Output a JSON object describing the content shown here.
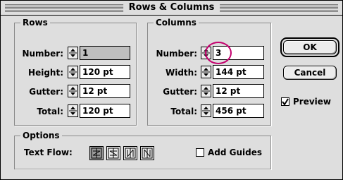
{
  "dialog": {
    "title": "Rows & Columns",
    "rows": {
      "legend": "Rows",
      "number_label": "Number:",
      "number_value": "1",
      "height_label": "Height:",
      "height_value": "120 pt",
      "gutter_label": "Gutter:",
      "gutter_value": "12 pt",
      "total_label": "Total:",
      "total_value": "120 pt"
    },
    "columns": {
      "legend": "Columns",
      "number_label": "Number:",
      "number_value": "3",
      "width_label": "Width:",
      "width_value": "144 pt",
      "gutter_label": "Gutter:",
      "gutter_value": "12 pt",
      "total_label": "Total:",
      "total_value": "456 pt"
    },
    "options": {
      "legend": "Options",
      "text_flow_label": "Text Flow:",
      "text_flow_icons": [
        "flow-left-right-top-down-icon",
        "flow-right-left-top-down-icon",
        "flow-top-down-left-right-icon",
        "flow-top-down-right-left-icon"
      ],
      "add_guides_label": "Add Guides",
      "add_guides_checked": false
    },
    "buttons": {
      "ok": "OK",
      "cancel": "Cancel"
    },
    "preview": {
      "label": "Preview",
      "checked": true
    },
    "highlight_color": "#c4006e"
  }
}
